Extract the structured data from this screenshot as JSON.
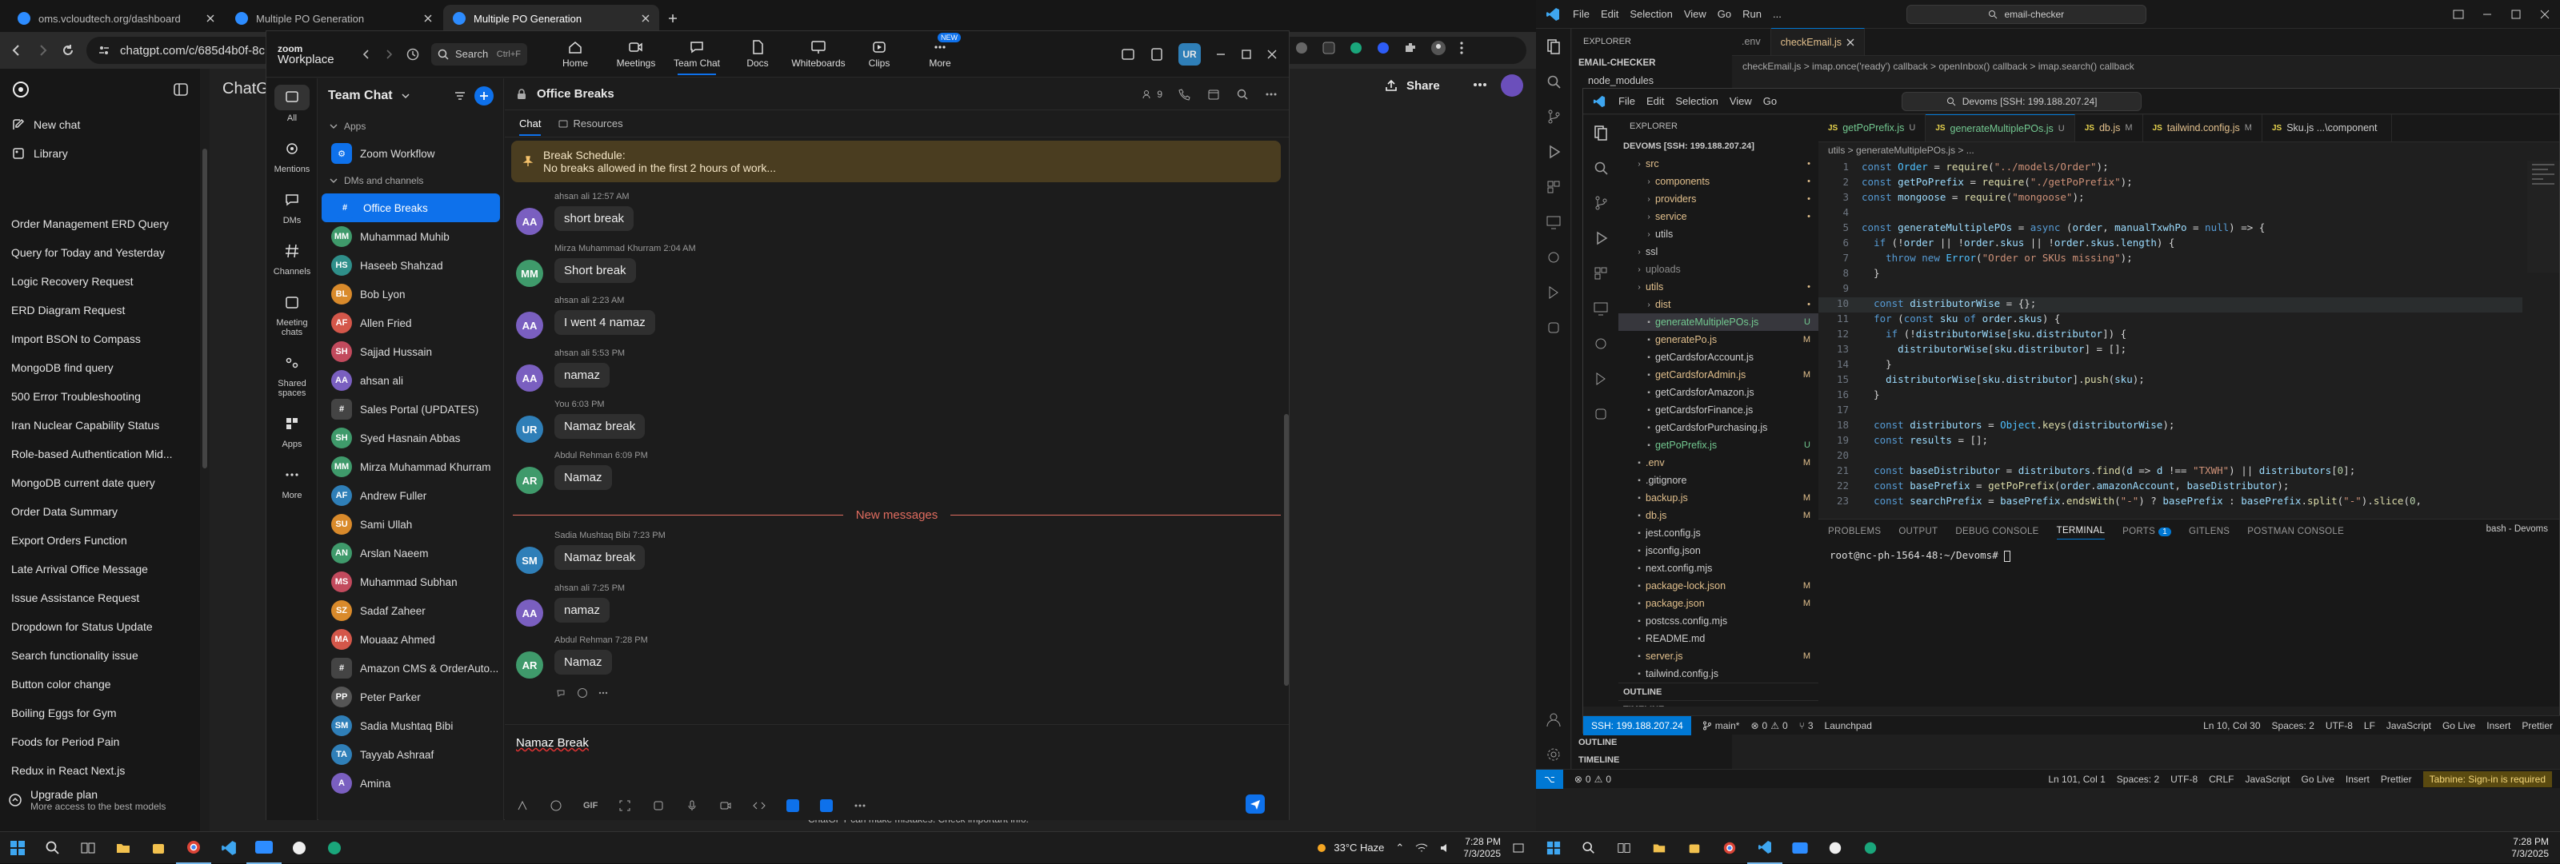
{
  "chrome": {
    "tabs": [
      {
        "title": "oms.vcloudtech.org/dashboard",
        "active": false
      },
      {
        "title": "Multiple PO Generation",
        "active": false
      },
      {
        "title": "Multiple PO Generation",
        "active": true
      }
    ],
    "url": "chatgpt.com/c/685d4b0f-8c"
  },
  "chatgpt": {
    "new_chat": "New chat",
    "library": "Library",
    "brand": "ChatG",
    "share": "Share",
    "disclaimer": "ChatGPT can make mistakes. Check important info.",
    "history": [
      "Order Management ERD Query",
      "Query for Today and Yesterday",
      "Logic Recovery Request",
      "ERD Diagram Request",
      "Import BSON to Compass",
      "MongoDB find query",
      "500 Error Troubleshooting",
      "Iran Nuclear Capability Status",
      "Role-based Authentication Mid...",
      "MongoDB current date query",
      "Order Data Summary",
      "Export Orders Function",
      "Late Arrival Office Message",
      "Issue Assistance Request",
      "Dropdown for Status Update",
      "Search functionality issue",
      "Button color change",
      "Boiling Eggs for Gym",
      "Foods for Period Pain",
      "Redux in React Next.js"
    ],
    "upgrade_title": "Upgrade plan",
    "upgrade_sub": "More access to the best models"
  },
  "zoom": {
    "brand_top": "zoom",
    "brand_bottom": "Workplace",
    "search_label": "Search",
    "search_shortcut": "Ctrl+F",
    "nav": [
      {
        "label": "Home",
        "icon": "home-icon"
      },
      {
        "label": "Meetings",
        "icon": "video-icon"
      },
      {
        "label": "Team Chat",
        "icon": "chat-icon"
      },
      {
        "label": "Docs",
        "icon": "doc-icon"
      },
      {
        "label": "Whiteboards",
        "icon": "whiteboard-icon"
      },
      {
        "label": "Clips",
        "icon": "clip-icon"
      },
      {
        "label": "More",
        "icon": "more-icon",
        "badge": "NEW"
      }
    ],
    "user_initials": "UR",
    "rail": [
      {
        "label": "All",
        "active": true
      },
      {
        "label": "Mentions"
      },
      {
        "label": "DMs"
      },
      {
        "label": "Channels"
      },
      {
        "label": "Meeting chats"
      },
      {
        "label": "Shared spaces"
      },
      {
        "label": "Apps"
      },
      {
        "label": "More"
      }
    ],
    "panel_title": "Team Chat",
    "apps_section": "Apps",
    "zoom_workflow": "Zoom Workflow",
    "dms_section": "DMs and channels",
    "contacts": [
      {
        "name": "Office Breaks",
        "initials": "#",
        "color": "#0e71eb",
        "active": true
      },
      {
        "name": "Muhammad Muhib",
        "initials": "MM",
        "color": "#3f9a6b"
      },
      {
        "name": "Haseeb Shahzad",
        "initials": "HS",
        "color": "#2f8f8a"
      },
      {
        "name": "Bob Lyon",
        "initials": "BL",
        "color": "#d98a2b"
      },
      {
        "name": "Allen Fried",
        "initials": "AF",
        "color": "#d4574a"
      },
      {
        "name": "Sajjad Hussain",
        "initials": "SH",
        "color": "#c24a5d"
      },
      {
        "name": "ahsan ali",
        "initials": "AA",
        "color": "#7a5fc0"
      },
      {
        "name": "Sales Portal (UPDATES)",
        "initials": "#",
        "color": "#444444"
      },
      {
        "name": "Syed Hasnain Abbas",
        "initials": "SH",
        "color": "#3f9a6b"
      },
      {
        "name": "Mirza Muhammad Khurram",
        "initials": "MM",
        "color": "#3f9a6b"
      },
      {
        "name": "Andrew Fuller",
        "initials": "AF",
        "color": "#2f7fb8"
      },
      {
        "name": "Sami Ullah",
        "initials": "SU",
        "color": "#d98a2b"
      },
      {
        "name": "Arslan Naeem",
        "initials": "AN",
        "color": "#3f9a6b"
      },
      {
        "name": "Muhammad Subhan",
        "initials": "MS",
        "color": "#c24a5d"
      },
      {
        "name": "Sadaf Zaheer",
        "initials": "SZ",
        "color": "#d98a2b"
      },
      {
        "name": "Mouaaz Ahmed",
        "initials": "MA",
        "color": "#d4574a"
      },
      {
        "name": "Amazon CMS & OrderAuto...",
        "initials": "#",
        "color": "#444444"
      },
      {
        "name": "Peter Parker",
        "initials": "PP",
        "color": "#555555"
      },
      {
        "name": "Sadia Mushtaq Bibi",
        "initials": "SM",
        "color": "#2f7fb8"
      },
      {
        "name": "Tayyab Ashraaf",
        "initials": "TA",
        "color": "#2f7fb8"
      },
      {
        "name": "Amina",
        "initials": "A",
        "color": "#7a5fc0"
      }
    ],
    "channel_title": "Office Breaks",
    "member_count": "9",
    "subtabs": [
      "Chat",
      "Resources"
    ],
    "banner_title": "Break Schedule:",
    "banner_text": "No breaks allowed in the first 2 hours of work...",
    "messages": [
      {
        "initials": "AA",
        "color": "#7a5fc0",
        "sender": "ahsan ali",
        "time": "12:57 AM",
        "text": "short break"
      },
      {
        "initials": "MM",
        "color": "#3f9a6b",
        "sender": "Mirza Muhammad Khurram",
        "time": "2:04 AM",
        "text": "Short break"
      },
      {
        "initials": "AA",
        "color": "#7a5fc0",
        "sender": "ahsan ali",
        "time": "2:23 AM",
        "text": "I went 4 namaz"
      },
      {
        "initials": "AA",
        "color": "#7a5fc0",
        "sender": "ahsan ali",
        "time": "5:53 PM",
        "text": "namaz"
      },
      {
        "initials": "UR",
        "color": "#2f7fb8",
        "sender": "You",
        "time": "6:03 PM",
        "text": "Namaz break"
      },
      {
        "initials": "AR",
        "color": "#3f9a6b",
        "sender": "Abdul Rehman",
        "time": "6:09 PM",
        "text": "Namaz"
      },
      {
        "initials": "SM",
        "color": "#2f7fb8",
        "sender": "Sadia Mushtaq Bibi",
        "time": "7:23 PM",
        "text": "Namaz break"
      },
      {
        "initials": "AA",
        "color": "#7a5fc0",
        "sender": "ahsan ali",
        "time": "7:25 PM",
        "text": "namaz"
      },
      {
        "initials": "AR",
        "color": "#3f9a6b",
        "sender": "Abdul Rehman",
        "time": "7:28 PM",
        "text": "Namaz"
      }
    ],
    "new_messages": "New messages",
    "compose_value": "Namaz Break"
  },
  "vscode": {
    "menu": [
      "File",
      "Edit",
      "Selection",
      "View",
      "Go",
      "Run",
      "..."
    ],
    "search": "email-checker",
    "outer_tabs": [
      ".env",
      "checkEmail.js"
    ],
    "outer_breadcrumb": "checkEmail.js > imap.once('ready') callback > openInbox() callback > imap.search() callback",
    "outer_explorer_title": "EXPLORER",
    "outer_folder": "EMAIL-CHECKER",
    "outer_first_item": "node_modules",
    "inner_menu": [
      "File",
      "Edit",
      "Selection",
      "View",
      "Go"
    ],
    "inner_search": "Devoms [SSH: 199.188.207.24]",
    "explorer_title": "EXPLORER",
    "root": "DEVOMS [SSH: 199.188.207.24]",
    "files": [
      {
        "name": "src",
        "indent": 1,
        "folder": true,
        "color": "#e2c08d",
        "status": "•"
      },
      {
        "name": "components",
        "indent": 2,
        "folder": true,
        "color": "#e2c08d",
        "status": "•"
      },
      {
        "name": "providers",
        "indent": 2,
        "folder": true,
        "color": "#e2c08d",
        "status": "•"
      },
      {
        "name": "service",
        "indent": 2,
        "folder": true,
        "color": "#e2c08d",
        "status": "•"
      },
      {
        "name": "utils",
        "indent": 2,
        "folder": true,
        "color": "#cccccc",
        "status": ""
      },
      {
        "name": "ssl",
        "indent": 1,
        "folder": true,
        "color": "#cccccc",
        "status": ""
      },
      {
        "name": "uploads",
        "indent": 1,
        "folder": true,
        "color": "#8b8b8b",
        "status": ""
      },
      {
        "name": "utils",
        "indent": 1,
        "folder": true,
        "color": "#e2c08d",
        "status": "•"
      },
      {
        "name": "dist",
        "indent": 2,
        "folder": true,
        "color": "#e2c08d",
        "status": "•"
      },
      {
        "name": "generateMultiplePOs.js",
        "indent": 2,
        "color": "#73c991",
        "status": "U",
        "sel": true
      },
      {
        "name": "generatePo.js",
        "indent": 2,
        "color": "#e2c08d",
        "status": "M"
      },
      {
        "name": "getCardsforAccount.js",
        "indent": 2,
        "color": "#cccccc",
        "status": ""
      },
      {
        "name": "getCardsforAdmin.js",
        "indent": 2,
        "color": "#e2c08d",
        "status": "M"
      },
      {
        "name": "getCardsforAmazon.js",
        "indent": 2,
        "color": "#cccccc",
        "status": ""
      },
      {
        "name": "getCardsforFinance.js",
        "indent": 2,
        "color": "#cccccc",
        "status": ""
      },
      {
        "name": "getCardsforPurchasing.js",
        "indent": 2,
        "color": "#cccccc",
        "status": ""
      },
      {
        "name": "getPoPrefix.js",
        "indent": 2,
        "color": "#73c991",
        "status": "U"
      },
      {
        "name": ".env",
        "indent": 1,
        "color": "#e2c08d",
        "status": "M"
      },
      {
        "name": ".gitignore",
        "indent": 1,
        "color": "#cccccc",
        "status": ""
      },
      {
        "name": "backup.js",
        "indent": 1,
        "color": "#e2c08d",
        "status": "M"
      },
      {
        "name": "db.js",
        "indent": 1,
        "color": "#e2c08d",
        "status": "M"
      },
      {
        "name": "jest.config.js",
        "indent": 1,
        "color": "#cccccc",
        "status": ""
      },
      {
        "name": "jsconfig.json",
        "indent": 1,
        "color": "#cccccc",
        "status": ""
      },
      {
        "name": "next.config.mjs",
        "indent": 1,
        "color": "#cccccc",
        "status": ""
      },
      {
        "name": "package-lock.json",
        "indent": 1,
        "color": "#e2c08d",
        "status": "M"
      },
      {
        "name": "package.json",
        "indent": 1,
        "color": "#e2c08d",
        "status": "M"
      },
      {
        "name": "postcss.config.mjs",
        "indent": 1,
        "color": "#cccccc",
        "status": ""
      },
      {
        "name": "README.md",
        "indent": 1,
        "color": "#cccccc",
        "status": ""
      },
      {
        "name": "server.js",
        "indent": 1,
        "color": "#e2c08d",
        "status": "M"
      },
      {
        "name": "tailwind.config.js",
        "indent": 1,
        "color": "#cccccc",
        "status": ""
      }
    ],
    "outline": "OUTLINE",
    "timeline": "TIMELINE",
    "editor_tabs": [
      {
        "name": "getPoPrefix.js",
        "status": "U"
      },
      {
        "name": "generateMultiplePOs.js",
        "status": "U",
        "active": true
      },
      {
        "name": "db.js",
        "status": "M"
      },
      {
        "name": "tailwind.config.js",
        "status": "M"
      },
      {
        "name": "Sku.js ...\\component",
        "status": ""
      }
    ],
    "breadcrumb": "utils > generateMultiplePOs.js > ...",
    "code_lines": [
      "const Order = require(\"../models/Order\");",
      "const getPoPrefix = require(\"./getPoPrefix\");",
      "const mongoose = require(\"mongoose\");",
      "",
      "const generateMultiplePOs = async (order, manualTxwhPo = null) => {",
      "  if (!order || !order.skus || !order.skus.length) {",
      "    throw new Error(\"Order or SKUs missing\");",
      "  }",
      "",
      "  const distributorWise = {};",
      "  for (const sku of order.skus) {",
      "    if (!distributorWise[sku.distributor]) {",
      "      distributorWise[sku.distributor] = [];",
      "    }",
      "    distributorWise[sku.distributor].push(sku);",
      "  }",
      "",
      "  const distributors = Object.keys(distributorWise);",
      "  const results = [];",
      "",
      "  const baseDistributor = distributors.find(d => d !== \"TXWH\") || distributors[0];",
      "  const basePrefix = getPoPrefix(order.amazonAccount, baseDistributor);",
      "  const searchPrefix = basePrefix.endsWith(\"-\") ? basePrefix : basePrefix.split(\"-\").slice(0,"
    ],
    "panel_tabs": [
      "PROBLEMS",
      "OUTPUT",
      "DEBUG CONSOLE",
      "TERMINAL",
      "PORTS",
      "GITLENS",
      "POSTMAN CONSOLE"
    ],
    "ports_count": "1",
    "terminal_label": "bash - Devoms",
    "terminal_prompt": "root@nc-ph-1564-48:~/Devoms# ",
    "inner_status": {
      "remote": "SSH: 199.188.207.24",
      "branch": "main*",
      "errors": "0",
      "warnings": "0",
      "ports": "3",
      "launchpad": "Launchpad",
      "position": "Ln 10, Col 30",
      "spaces": "Spaces: 2",
      "encoding": "UTF-8",
      "eol": "LF",
      "language": "JavaScript",
      "golive": "Go Live",
      "insert": "Insert",
      "prettier": "Prettier"
    },
    "outer_status": {
      "errors": "0",
      "warnings": "0",
      "position": "Ln 101, Col 1",
      "spaces": "Spaces: 2",
      "encoding": "UTF-8",
      "eol": "CRLF",
      "language": "JavaScript",
      "golive": "Go Live",
      "insert": "Insert",
      "prettier": "Prettier",
      "tabnine": "Tabnine: Sign-in is required"
    }
  },
  "taskbar": {
    "weather": "33°C Haze",
    "time": "7:28 PM",
    "date": "7/3/2025"
  }
}
